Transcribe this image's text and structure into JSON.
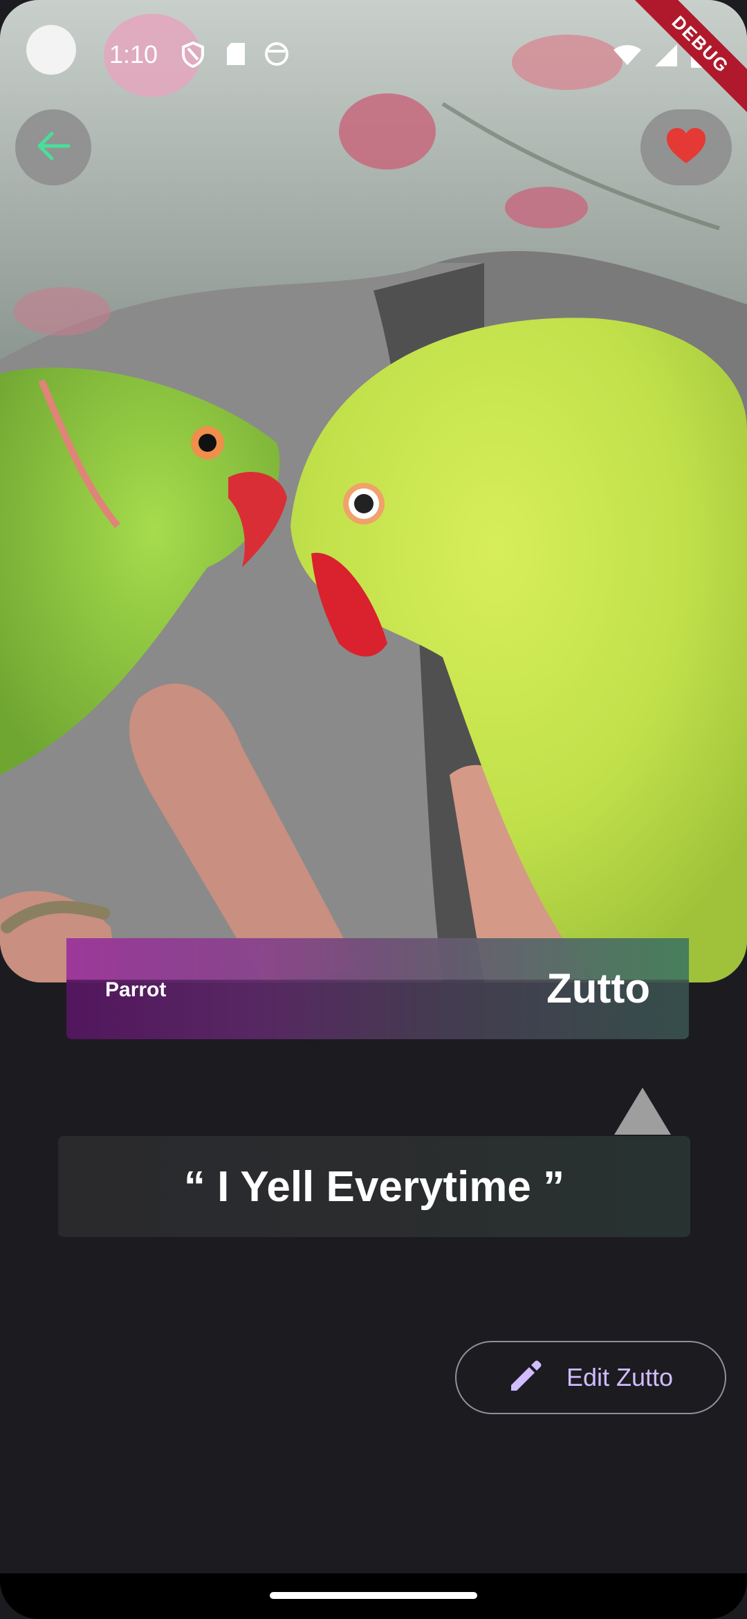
{
  "status_bar": {
    "time": "1:10",
    "left_icons": [
      "shield-icon",
      "sd-card-icon",
      "face-icon"
    ],
    "right_icons": [
      "wifi-icon",
      "signal-icon",
      "battery-icon"
    ]
  },
  "debug_banner": "DEBUG",
  "header": {
    "back_icon": "arrow-left-icon",
    "favorite_icon": "heart-icon",
    "back_color": "#4ade9a",
    "favorite_color": "#e53935"
  },
  "pet": {
    "species": "Parrot",
    "name": "Zutto"
  },
  "quote": "“ I Yell Everytime ”",
  "edit_button": {
    "label": "Edit Zutto",
    "icon": "pencil-icon",
    "color": "#d0bcff"
  }
}
